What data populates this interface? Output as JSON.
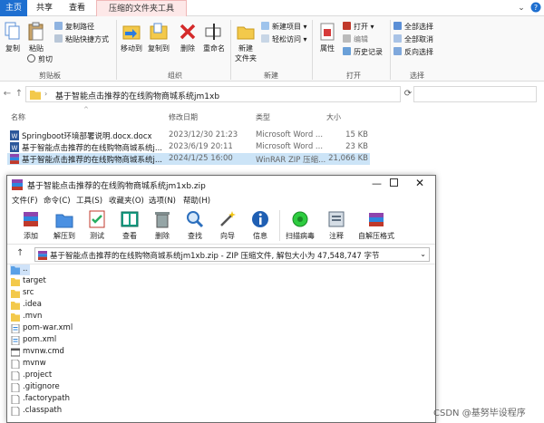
{
  "explorer": {
    "tabs": [
      {
        "label": "主页"
      },
      {
        "label": "共享"
      },
      {
        "label": "查看"
      },
      {
        "label": "压缩的文件夹工具"
      }
    ],
    "ribbon": {
      "clipboard": {
        "pin_label": "固定到\n快速访问",
        "copy_label": "复制",
        "paste_label": "粘贴",
        "copy_path_label": "复制路径",
        "paste_shortcut_label": "粘贴快捷方式",
        "cut_label": "剪切",
        "group_label": "剪贴板"
      },
      "organize": {
        "move_to_label": "移动到",
        "copy_to_label": "复制到",
        "delete_label": "删除",
        "rename_label": "重命名",
        "group_label": "组织"
      },
      "new": {
        "new_folder_label": "新建\n文件夹",
        "new_item_label": "新建项目",
        "easy_access_label": "轻松访问",
        "group_label": "新建"
      },
      "open": {
        "properties_label": "属性",
        "open_label": "打开",
        "edit_label": "编辑",
        "history_label": "历史记录",
        "group_label": "打开"
      },
      "select": {
        "select_all_label": "全部选择",
        "select_none_label": "全部取消",
        "invert_label": "反向选择",
        "group_label": "选择"
      }
    },
    "address": {
      "path": "基于智能点击推荐的在线购物商城系统jm1xb"
    },
    "columns": {
      "name": "名称",
      "date": "修改日期",
      "type": "类型",
      "size": "大小"
    },
    "files": [
      {
        "name": "Springboot环境部署说明.docx.docx",
        "date": "2023/12/30 21:23",
        "type": "Microsoft Word ...",
        "size": "15 KB"
      },
      {
        "name": "基于智能点击推荐的在线购物商城系统j...",
        "date": "2023/6/19 20:11",
        "type": "Microsoft Word ...",
        "size": "23 KB"
      },
      {
        "name": "基于智能点击推荐的在线购物商城系统j...",
        "date": "2024/1/25 16:00",
        "type": "WinRAR ZIP 压缩...",
        "size": "21,066 KB"
      }
    ]
  },
  "winrar": {
    "title": "基于智能点击推荐的在线购物商城系统jm1xb.zip",
    "menu": [
      {
        "label": "文件(F)"
      },
      {
        "label": "命令(C)"
      },
      {
        "label": "工具(S)"
      },
      {
        "label": "收藏夹(O)"
      },
      {
        "label": "选项(N)"
      },
      {
        "label": "帮助(H)"
      }
    ],
    "toolbar": [
      {
        "label": "添加",
        "color": "#c0392b"
      },
      {
        "label": "解压到",
        "color": "#2e86de"
      },
      {
        "label": "测试",
        "color": "#27ae60"
      },
      {
        "label": "查看",
        "color": "#16a085"
      },
      {
        "label": "删除",
        "color": "#7f8c8d"
      },
      {
        "label": "查找",
        "color": "#2c6fbd"
      },
      {
        "label": "向导",
        "color": "#8e44ad"
      },
      {
        "label": "信息",
        "color": "#1f5fb3"
      },
      {
        "label": "扫描病毒",
        "color": "#2ecc40"
      },
      {
        "label": "注释",
        "color": "#5d6d7e"
      },
      {
        "label": "自解压格式",
        "color": "#c0392b"
      }
    ],
    "path_text": "基于智能点击推荐的在线购物商城系统jm1xb.zip - ZIP 压缩文件, 解包大小为 47,548,747 字节",
    "items": [
      {
        "name": "..",
        "icon": "parent-folder-icon"
      },
      {
        "name": "target",
        "icon": "folder-icon"
      },
      {
        "name": "src",
        "icon": "folder-icon"
      },
      {
        "name": ".idea",
        "icon": "folder-icon"
      },
      {
        "name": ".mvn",
        "icon": "folder-icon"
      },
      {
        "name": "pom-war.xml",
        "icon": "xml-file-icon"
      },
      {
        "name": "pom.xml",
        "icon": "xml-file-icon"
      },
      {
        "name": "mvnw.cmd",
        "icon": "cmd-file-icon"
      },
      {
        "name": "mvnw",
        "icon": "file-icon"
      },
      {
        "name": ".project",
        "icon": "file-icon"
      },
      {
        "name": ".gitignore",
        "icon": "file-icon"
      },
      {
        "name": ".factorypath",
        "icon": "file-icon"
      },
      {
        "name": ".classpath",
        "icon": "file-icon"
      }
    ]
  },
  "watermark": "CSDN @基努毕设程序",
  "colors": {
    "accent": "#1e6fd0",
    "selection": "#cce4f7",
    "folder": "#f3c94b"
  }
}
